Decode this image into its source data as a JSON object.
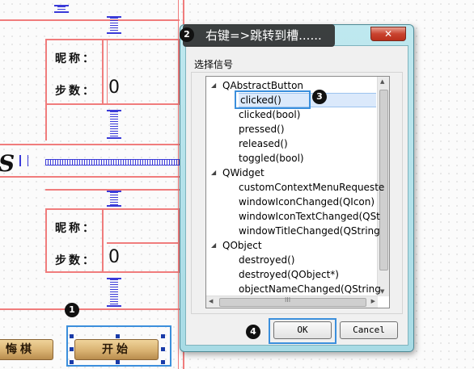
{
  "designer": {
    "top_group": {
      "nickname_label": "昵称：",
      "steps_label": "步数：",
      "steps_value": "0"
    },
    "bottom_group": {
      "nickname_label": "昵称：",
      "steps_label": "步数：",
      "steps_value": "0"
    },
    "left_button_label": "悔棋",
    "start_button_label": "开始",
    "left_edge_glyph": "S"
  },
  "tooltip": {
    "text": "右键=>跳转到槽......"
  },
  "dialog": {
    "close_glyph": "✕",
    "group_label": "选择信号",
    "ok_label": "OK",
    "cancel_label": "Cancel",
    "scroll_glyph_left": "◀",
    "scroll_glyph_right": "▶",
    "scroll_glyph_mid": "III",
    "scroll_glyph_up": "▲",
    "scroll_glyph_down": "▼",
    "tree": [
      {
        "label": "QAbstractButton",
        "kind": "class",
        "expanded": true
      },
      {
        "label": "clicked()",
        "kind": "signal",
        "selected": true
      },
      {
        "label": "clicked(bool)",
        "kind": "signal"
      },
      {
        "label": "pressed()",
        "kind": "signal"
      },
      {
        "label": "released()",
        "kind": "signal"
      },
      {
        "label": "toggled(bool)",
        "kind": "signal"
      },
      {
        "label": "QWidget",
        "kind": "class",
        "expanded": true
      },
      {
        "label": "customContextMenuRequeste",
        "kind": "signal"
      },
      {
        "label": "windowIconChanged(QIcon)",
        "kind": "signal"
      },
      {
        "label": "windowIconTextChanged(QSt",
        "kind": "signal"
      },
      {
        "label": "windowTitleChanged(QString",
        "kind": "signal"
      },
      {
        "label": "QObject",
        "kind": "class",
        "expanded": true
      },
      {
        "label": "destroyed()",
        "kind": "signal"
      },
      {
        "label": "destroyed(QObject*)",
        "kind": "signal"
      },
      {
        "label": "objectNameChanged(QString",
        "kind": "signal"
      }
    ]
  },
  "badges": [
    "1",
    "2",
    "3",
    "4"
  ],
  "colors": {
    "layout_red": "#f07c7c",
    "spacer_blue": "#3a3ad8",
    "highlight_blue": "#3b8fdc",
    "dialog_frame": "#a8dbe5"
  }
}
